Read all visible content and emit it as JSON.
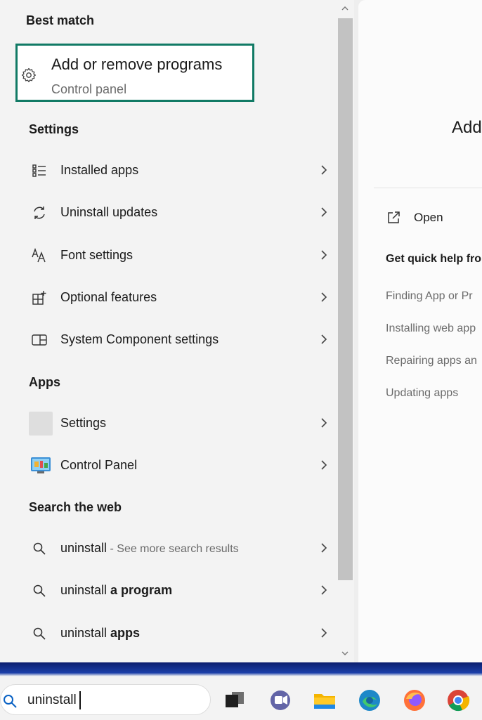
{
  "best_match": {
    "section_title": "Best match",
    "title": "Add or remove programs",
    "subtitle": "Control panel",
    "highlight_color": "#117a65"
  },
  "settings": {
    "section_title": "Settings",
    "items": [
      {
        "label": "Installed apps",
        "icon": "list-icon"
      },
      {
        "label": "Uninstall updates",
        "icon": "refresh-icon"
      },
      {
        "label": "Font settings",
        "icon": "font-icon"
      },
      {
        "label": "Optional features",
        "icon": "grid-plus-icon"
      },
      {
        "label": "System Component settings",
        "icon": "component-icon"
      }
    ]
  },
  "apps": {
    "section_title": "Apps",
    "items": [
      {
        "label": "Settings",
        "icon": "settings-app-icon"
      },
      {
        "label": "Control Panel",
        "icon": "control-panel-icon"
      }
    ]
  },
  "web": {
    "section_title": "Search the web",
    "items": [
      {
        "query": "uninstall",
        "suffix": " - See more search results"
      },
      {
        "query": "uninstall ",
        "bold": "a program"
      },
      {
        "query": "uninstall ",
        "bold": "apps"
      }
    ]
  },
  "preview": {
    "title": "Add",
    "open_label": "Open",
    "help_title": "Get quick help fro",
    "help_links": [
      "Finding App or Pr",
      "Installing web app",
      "Repairing apps an",
      "Updating apps"
    ]
  },
  "taskbar": {
    "search_value": "uninstall",
    "icons": [
      "task-view-icon",
      "teams-icon",
      "file-explorer-icon",
      "edge-icon",
      "firefox-icon",
      "chrome-icon"
    ]
  }
}
